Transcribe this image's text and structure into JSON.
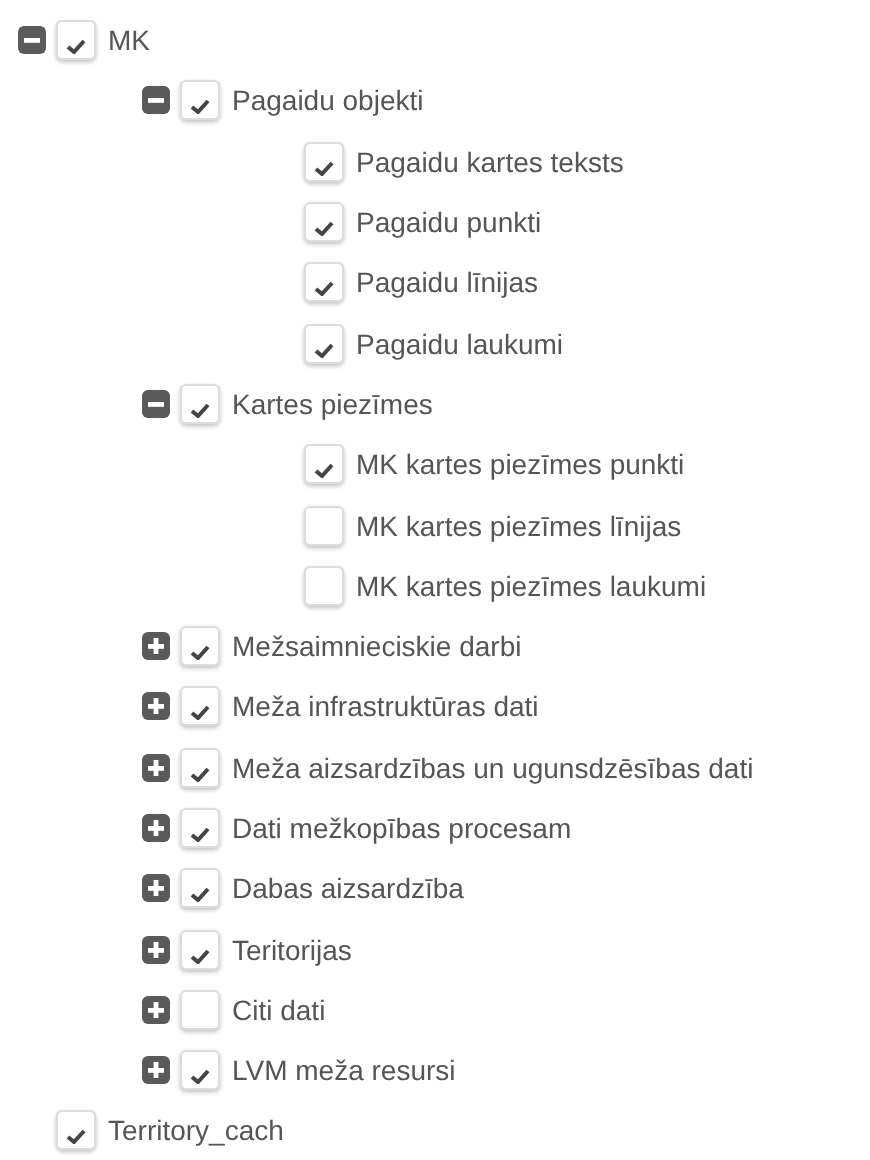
{
  "tree": [
    {
      "label": "MK",
      "checked": true,
      "expanded": true,
      "children": [
        {
          "label": "Pagaidu objekti",
          "checked": true,
          "expanded": true,
          "children": [
            {
              "label": "Pagaidu kartes teksts",
              "checked": true
            },
            {
              "label": "Pagaidu punkti",
              "checked": true
            },
            {
              "label": "Pagaidu līnijas",
              "checked": true
            },
            {
              "label": "Pagaidu laukumi",
              "checked": true
            }
          ]
        },
        {
          "label": "Kartes piezīmes",
          "checked": true,
          "expanded": true,
          "children": [
            {
              "label": "MK kartes piezīmes punkti",
              "checked": true
            },
            {
              "label": "MK kartes piezīmes līnijas",
              "checked": false
            },
            {
              "label": "MK kartes piezīmes laukumi",
              "checked": false
            }
          ]
        },
        {
          "label": "Mežsaimnieciskie darbi",
          "checked": true,
          "expanded": false
        },
        {
          "label": "Meža infrastruktūras dati",
          "checked": true,
          "expanded": false
        },
        {
          "label": "Meža aizsardzības un ugunsdzēsības dati",
          "checked": true,
          "expanded": false
        },
        {
          "label": "Dati mežkopības procesam",
          "checked": true,
          "expanded": false
        },
        {
          "label": "Dabas aizsardzība",
          "checked": true,
          "expanded": false
        },
        {
          "label": "Teritorijas",
          "checked": true,
          "expanded": false
        },
        {
          "label": "Citi dati",
          "checked": false,
          "expanded": false
        },
        {
          "label": "LVM meža resursi",
          "checked": true,
          "expanded": false
        }
      ]
    },
    {
      "label": "Territory_cach",
      "checked": true
    }
  ]
}
